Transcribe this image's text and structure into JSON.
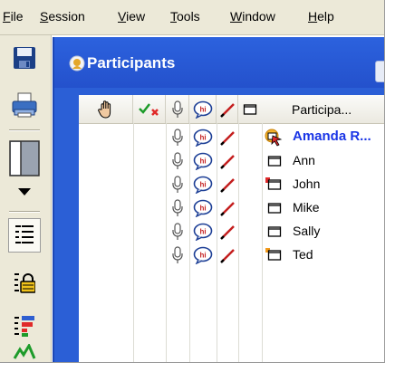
{
  "menubar": {
    "items": [
      {
        "label": "File",
        "accel": "F",
        "rest": "ile"
      },
      {
        "label": "Session",
        "accel": "S",
        "rest": "ession"
      },
      {
        "label": "View",
        "accel": "V",
        "rest": "iew"
      },
      {
        "label": "Tools",
        "accel": "T",
        "rest": "ools"
      },
      {
        "label": "Window",
        "accel": "W",
        "rest": "indow"
      },
      {
        "label": "Help",
        "accel": "H",
        "rest": "elp"
      }
    ]
  },
  "toolbar": {
    "buttons": [
      "save-icon",
      "print-icon",
      "layout-icon",
      "dropdown-arrow-icon",
      "participant-list-icon",
      "lock-list-icon",
      "color-list-icon",
      "status-icon"
    ]
  },
  "panel": {
    "title": "Participants"
  },
  "list": {
    "name_header": "Participa...",
    "participants": [
      {
        "name": "Amanda R...",
        "is_self": true,
        "status": "presenter"
      },
      {
        "name": "Ann",
        "is_self": false,
        "status": "none"
      },
      {
        "name": "John",
        "is_self": false,
        "status": "red-flag"
      },
      {
        "name": "Mike",
        "is_self": false,
        "status": "none"
      },
      {
        "name": "Sally",
        "is_self": false,
        "status": "none"
      },
      {
        "name": "Ted",
        "is_self": false,
        "status": "orange-flag"
      }
    ]
  },
  "colors": {
    "panel_blue": "#2b5fd6",
    "self_name": "#1a35e6",
    "menubar_bg": "#ece9d8"
  }
}
